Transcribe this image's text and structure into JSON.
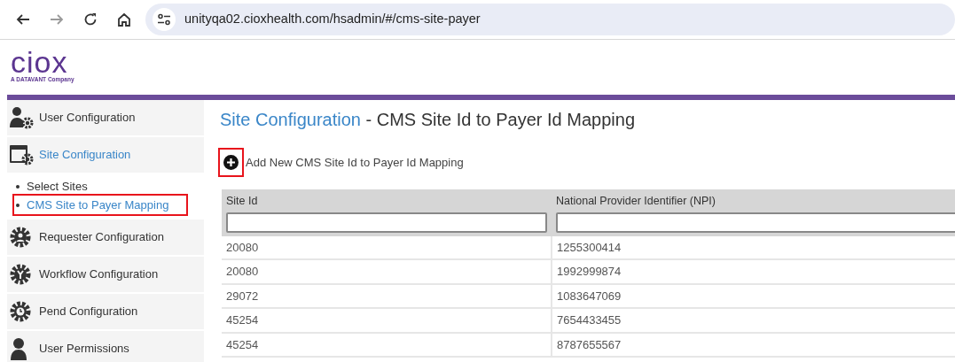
{
  "browser": {
    "url": "unityqa02.cioxhealth.com/hsadmin/#/cms-site-payer",
    "forward_disabled": true
  },
  "logo": {
    "name": "ciox",
    "tagline": "A DATAVANT Company"
  },
  "sidebar": {
    "items": [
      {
        "label": "User Configuration",
        "selected": false
      },
      {
        "label": "Site Configuration",
        "selected": true,
        "children": [
          {
            "label": "Select Sites",
            "selected": false,
            "highlighted": false
          },
          {
            "label": "CMS Site to Payer Mapping",
            "selected": true,
            "highlighted": true
          }
        ]
      },
      {
        "label": "Requester Configuration",
        "selected": false
      },
      {
        "label": "Workflow Configuration",
        "selected": false
      },
      {
        "label": "Pend Configuration",
        "selected": false
      },
      {
        "label": "User Permissions",
        "selected": false
      }
    ]
  },
  "page": {
    "section": "Site Configuration",
    "title": "- CMS Site Id to Payer Id Mapping"
  },
  "add_link": {
    "label": "Add New CMS Site Id to Payer Id Mapping",
    "highlighted": true
  },
  "table": {
    "columns": [
      "Site Id",
      "National Provider Identifier (NPI)"
    ],
    "rows": [
      [
        "20080",
        "1255300414"
      ],
      [
        "20080",
        "1992999874"
      ],
      [
        "29072",
        "1083647069"
      ],
      [
        "45254",
        "7654433455"
      ],
      [
        "45254",
        "8787655567"
      ]
    ]
  }
}
